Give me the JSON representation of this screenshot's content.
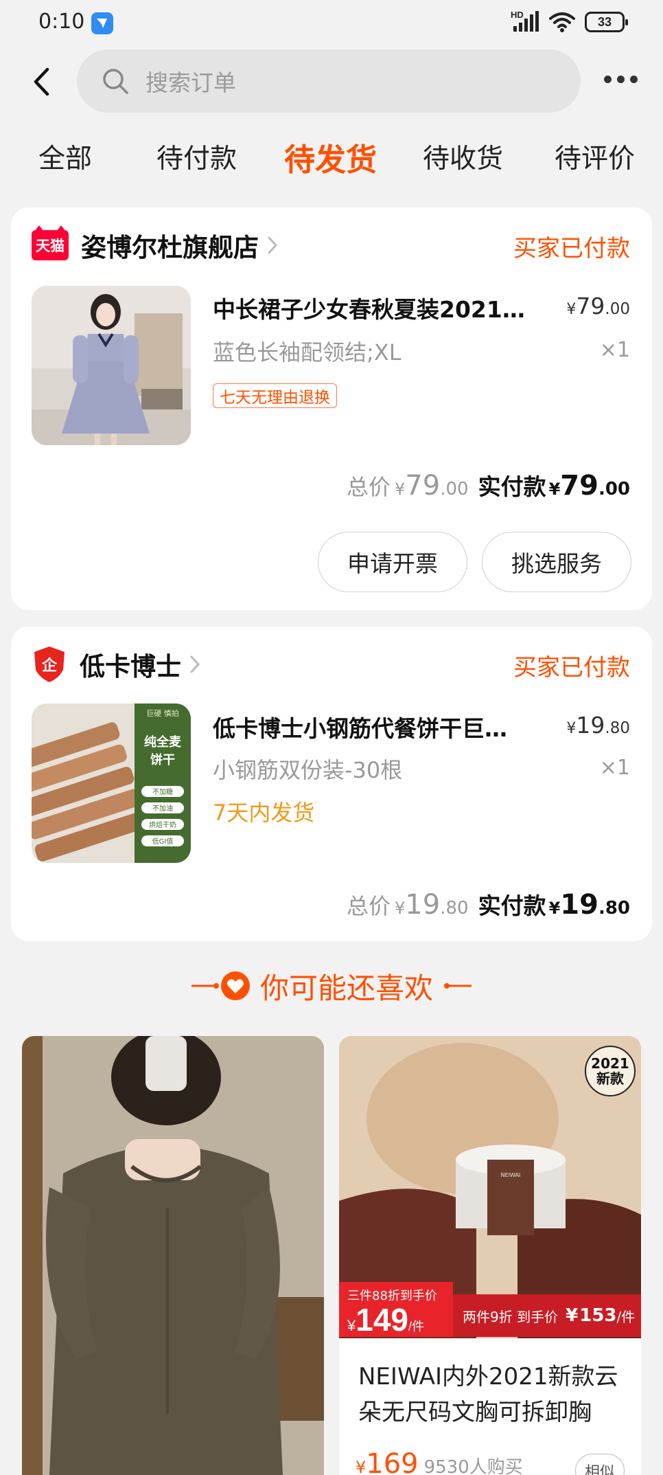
{
  "status_bar": {
    "time": "0:10",
    "network": "HD",
    "battery": "33"
  },
  "header": {
    "search_placeholder": "搜索订单"
  },
  "tabs": [
    {
      "label": "全部"
    },
    {
      "label": "待付款"
    },
    {
      "label": "待发货",
      "active": true
    },
    {
      "label": "待收货"
    },
    {
      "label": "待评价"
    }
  ],
  "orders": [
    {
      "shop_logo": "天猫",
      "shop_name": "姿博尔杜旗舰店",
      "status": "买家已付款",
      "product": {
        "title": "中长裙子少女春秋夏装2021…",
        "price_currency": "¥",
        "price_int": "79",
        "price_dec": ".00",
        "sku": "蓝色长袖配领结;XL",
        "qty": "×1",
        "tag": "七天无理由退换"
      },
      "total_label": "总价",
      "total_int": "79",
      "total_dec": ".00",
      "paid_label": "实付款",
      "paid_int": "79",
      "paid_dec": ".00",
      "currency": "¥",
      "actions": [
        "申请开票",
        "挑选服务"
      ]
    },
    {
      "shop_logo": "企",
      "shop_name": "低卡博士",
      "status": "买家已付款",
      "product": {
        "title": "低卡博士小钢筋代餐饼干巨…",
        "price_currency": "¥",
        "price_int": "19",
        "price_dec": ".80",
        "sku": "小钢筋双份装-30根",
        "qty": "×1",
        "ship_note": "7天内发货",
        "image_text": {
          "corner": "巨硬 慎拍",
          "headline": "纯全麦饼干",
          "pills": [
            "不加糖",
            "不加油",
            "烘焙干奶",
            "低GI值"
          ]
        }
      },
      "total_label": "总价",
      "total_int": "19",
      "total_dec": ".80",
      "paid_label": "实付款",
      "paid_int": "19",
      "paid_dec": ".80",
      "currency": "¥"
    }
  ],
  "recommend": {
    "title": "你可能还喜欢",
    "items": [
      {
        "image": "dress-photo"
      },
      {
        "image": "bra-photo",
        "badge_line1": "2021",
        "badge_line2": "新款",
        "promo_left_line1": "三件88折到手价",
        "promo_price": "149",
        "promo_unit": "/件",
        "promo_right_text": "两件9折 到手价",
        "promo_right_price": "153",
        "promo_right_unit": "/件",
        "name": "NEIWAI内外2021新款云朵无尺码文胸可拆卸胸",
        "price": "169",
        "sold": "9530人购买",
        "similar_label": "相似"
      }
    ]
  },
  "colors": {
    "accent": "#ff5000",
    "tmall_red": "#ff0036",
    "ship_orange": "#f29a1a",
    "background": "#f2f2f2"
  }
}
